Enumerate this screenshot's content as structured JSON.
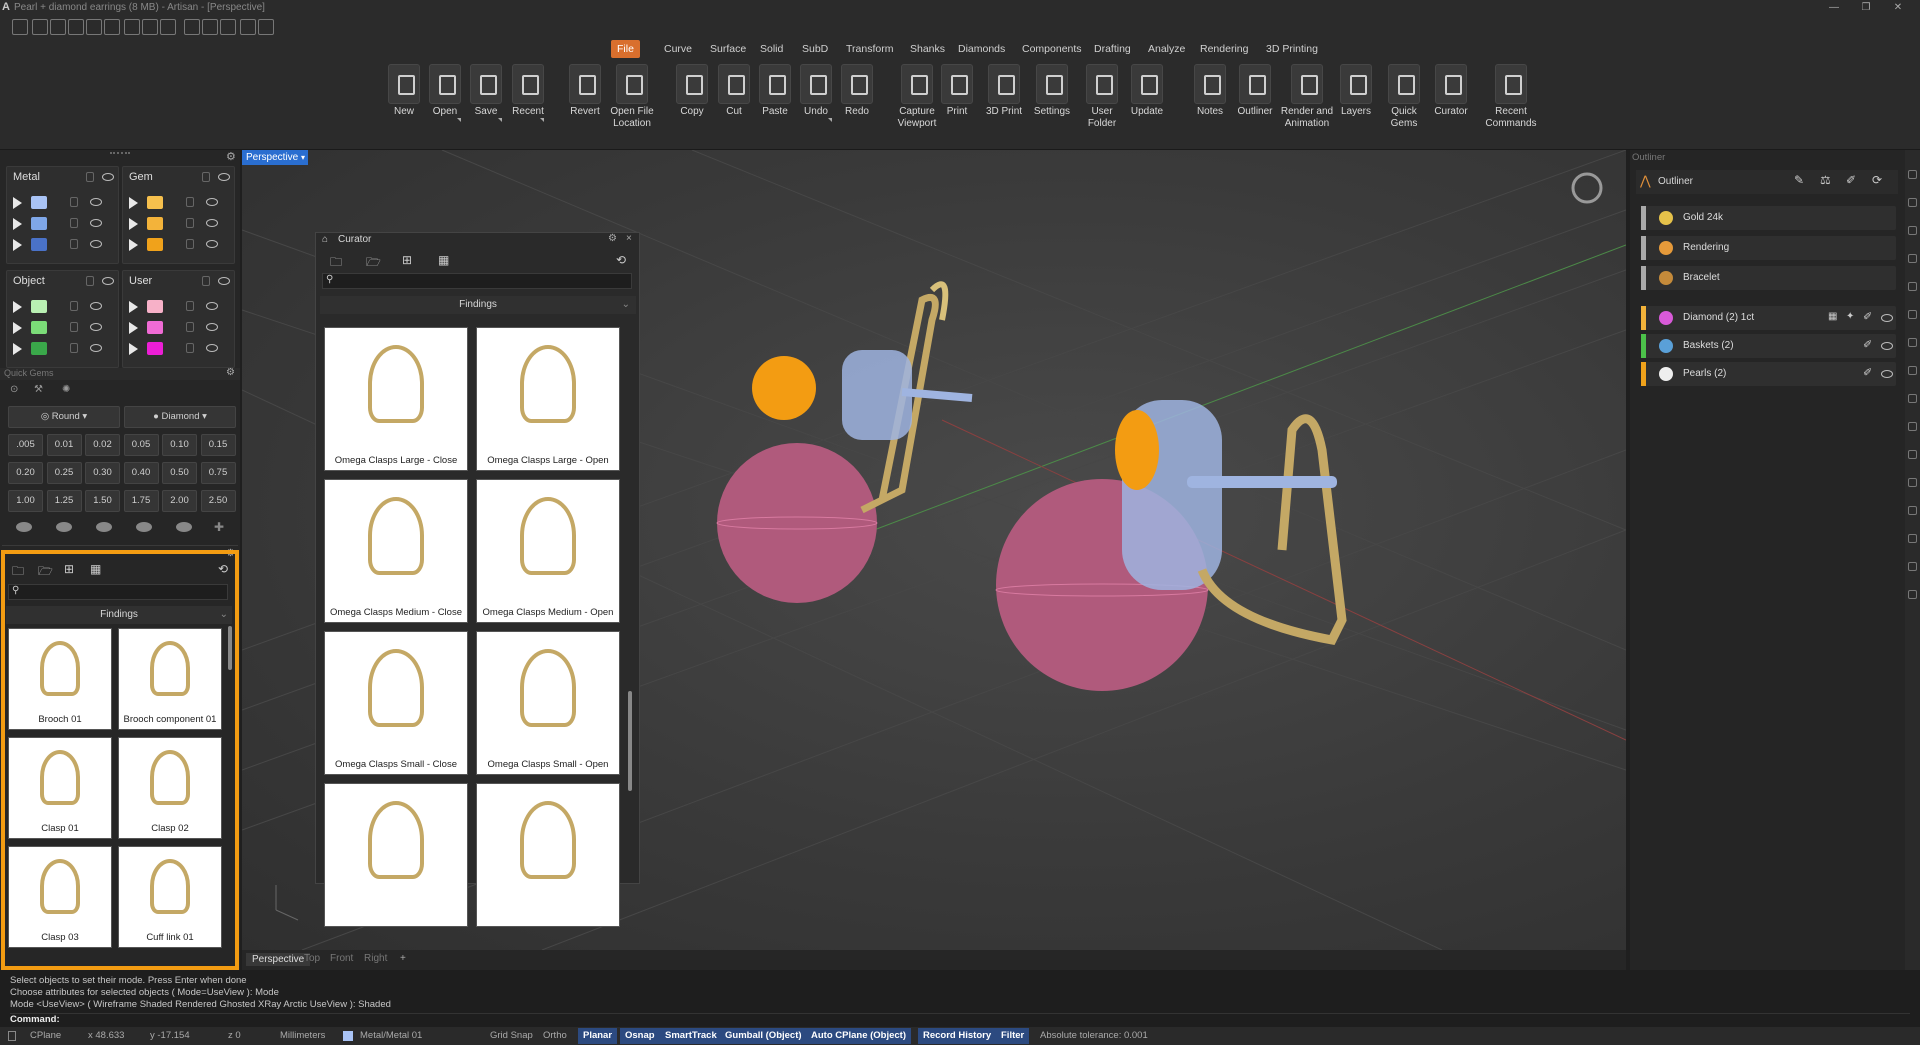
{
  "window": {
    "title": "Pearl + diamond earrings (8 MB) - Artisan - [Perspective]"
  },
  "menu": {
    "tabs": [
      "File",
      "Curve",
      "Surface",
      "Solid",
      "SubD",
      "Transform",
      "Shanks",
      "Diamonds",
      "Components",
      "Drafting",
      "Analyze",
      "Rendering",
      "3D Printing"
    ],
    "active": "File"
  },
  "ribbon": {
    "buttons": [
      "New",
      "Open",
      "Save",
      "Recent",
      "Revert",
      "Open File Location",
      "Copy",
      "Cut",
      "Paste",
      "Undo",
      "Redo",
      "Capture Viewport",
      "Print",
      "3D Print",
      "Settings",
      "User Folder",
      "Update",
      "Notes",
      "Outliner",
      "Render and Animation",
      "Layers",
      "Quick Gems",
      "Curator",
      "Recent Commands"
    ]
  },
  "layers": {
    "metal": {
      "title": "Metal",
      "colors": [
        "#a9c3f5",
        "#7fa7e8",
        "#4a72c8"
      ]
    },
    "gem": {
      "title": "Gem",
      "colors": [
        "#f6c04d",
        "#f3b33a",
        "#f0a21b"
      ]
    },
    "object": {
      "title": "Object",
      "colors": [
        "#b9f0b3",
        "#7bdc78",
        "#3aa84a"
      ]
    },
    "user": {
      "title": "User",
      "colors": [
        "#f7b1c8",
        "#f06bd5",
        "#ec1ed6"
      ]
    }
  },
  "quick_gems": {
    "title": "Quick Gems",
    "shape": "Round",
    "material": "Diamond",
    "sizes": [
      ".005",
      "0.01",
      "0.02",
      "0.05",
      "0.10",
      "0.15",
      "0.20",
      "0.25",
      "0.30",
      "0.40",
      "0.50",
      "0.75",
      "1.00",
      "1.25",
      "1.50",
      "1.75",
      "2.00",
      "2.50"
    ]
  },
  "left_curator": {
    "category": "Findings",
    "items": [
      "Brooch 01",
      "Brooch component 01",
      "Clasp 01",
      "Clasp 02",
      "Clasp 03",
      "Cuff link 01"
    ]
  },
  "viewport": {
    "name": "Perspective",
    "tabs": [
      "Perspective",
      "Top",
      "Front",
      "Right"
    ]
  },
  "curator": {
    "title": "Curator",
    "category": "Findings",
    "items": [
      "Omega Clasps Large - Close",
      "Omega Clasps Large - Open",
      "Omega Clasps Medium - Close",
      "Omega Clasps Medium - Open",
      "Omega Clasps Small - Close",
      "Omega Clasps Small - Open",
      "",
      ""
    ]
  },
  "outliner": {
    "panel_title": "Outliner",
    "header": "Outliner",
    "groups": [
      {
        "name": "Gold 24k",
        "bar": "#aaaaaa",
        "dot": "#e6c24a"
      },
      {
        "name": "Rendering",
        "bar": "#aaaaaa",
        "dot": "#e69a3a"
      },
      {
        "name": "Bracelet",
        "bar": "#aaaaaa",
        "dot": "#c48a3a"
      }
    ],
    "objects": [
      {
        "name": "Diamond (2) 1ct",
        "bar": "#f3b33a",
        "dot": "#d85ad8"
      },
      {
        "name": "Baskets (2)",
        "bar": "#4cc24a",
        "dot": "#5aa0d8"
      },
      {
        "name": "Pearls (2)",
        "bar": "#f0a21b",
        "dot": "#eeeeee"
      }
    ]
  },
  "command": {
    "lines": [
      "Select objects to set their mode. Press Enter when done",
      "Choose attributes for selected objects ( Mode=UseView ): Mode",
      "Mode <UseView> ( Wireframe  Shaded  Rendered  Ghosted  XRay  Arctic  UseView ): Shaded"
    ],
    "prompt": "Command:"
  },
  "status": {
    "cplane": "CPlane",
    "x": "x 48.633",
    "y": "y -17.154",
    "z": "z 0",
    "units": "Millimeters",
    "layer": "Metal/Metal 01",
    "toggles": [
      {
        "label": "Grid Snap",
        "on": false
      },
      {
        "label": "Ortho",
        "on": false
      },
      {
        "label": "Planar",
        "on": true
      },
      {
        "label": "Osnap",
        "on": true
      },
      {
        "label": "SmartTrack",
        "on": true
      },
      {
        "label": "Gumball (Object)",
        "on": true
      },
      {
        "label": "Auto CPlane (Object)",
        "on": true
      },
      {
        "label": "Record History",
        "on": true
      },
      {
        "label": "Filter",
        "on": true
      }
    ],
    "tolerance": "Absolute tolerance: 0.001"
  }
}
